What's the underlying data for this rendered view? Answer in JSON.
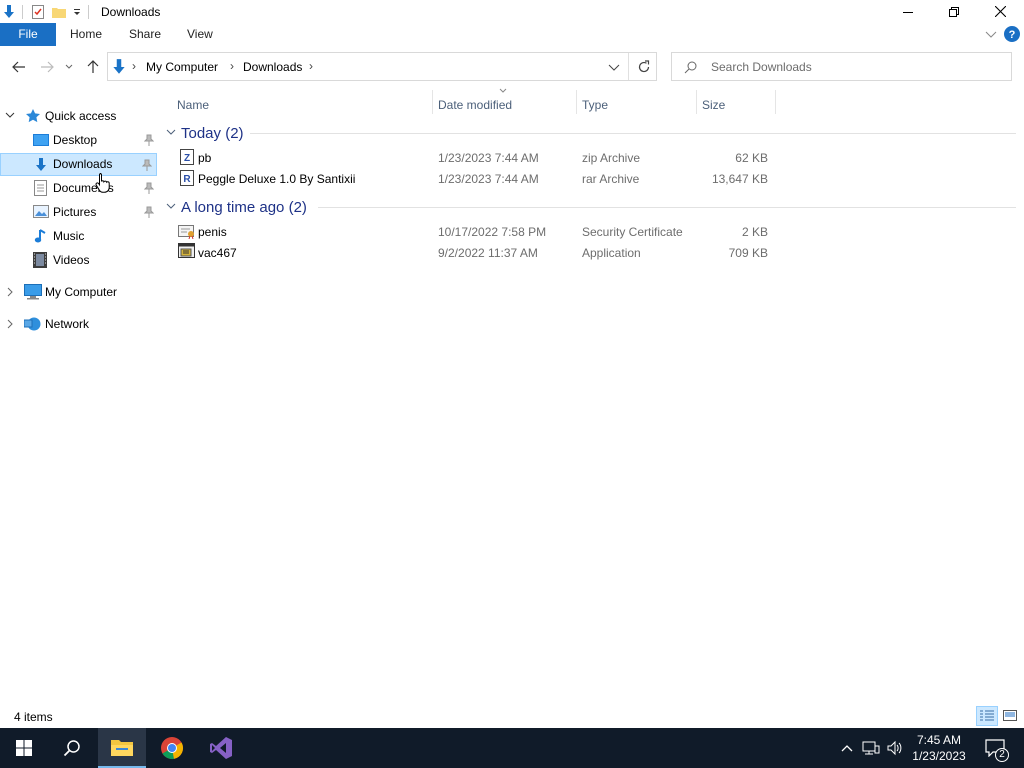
{
  "window": {
    "title": "Downloads"
  },
  "ribbon": {
    "tabs": [
      "File",
      "Home",
      "Share",
      "View"
    ]
  },
  "address": {
    "crumbs": [
      "My Computer",
      "Downloads"
    ]
  },
  "search": {
    "placeholder": "Search Downloads"
  },
  "nav": {
    "quick_access": "Quick access",
    "items": [
      "Desktop",
      "Downloads",
      "Documents",
      "Pictures",
      "Music",
      "Videos"
    ],
    "my_computer": "My Computer",
    "network": "Network"
  },
  "columns": [
    "Name",
    "Date modified",
    "Type",
    "Size"
  ],
  "groups": [
    {
      "label": "Today (2)",
      "files": [
        {
          "name": "pb",
          "date": "1/23/2023 7:44 AM",
          "type": "zip Archive",
          "size": "62 KB",
          "icon": "zip-archive-icon"
        },
        {
          "name": "Peggle Deluxe 1.0 By Santixii",
          "date": "1/23/2023 7:44 AM",
          "type": "rar Archive",
          "size": "13,647 KB",
          "icon": "rar-archive-icon"
        }
      ]
    },
    {
      "label": "A long time ago (2)",
      "files": [
        {
          "name": "penis",
          "date": "10/17/2022 7:58 PM",
          "type": "Security Certificate",
          "size": "2 KB",
          "icon": "certificate-icon"
        },
        {
          "name": "vac467",
          "date": "9/2/2022 11:37 AM",
          "type": "Application",
          "size": "709 KB",
          "icon": "application-icon"
        }
      ]
    }
  ],
  "status": {
    "item_count": "4 items"
  },
  "taskbar": {
    "time": "7:45 AM",
    "date": "1/23/2023",
    "notification_count": "2"
  },
  "colors": {
    "accent": "#1a6fc4",
    "selected": "#cce8ff",
    "taskbar": "#101b29",
    "group_text": "#1e3287"
  }
}
